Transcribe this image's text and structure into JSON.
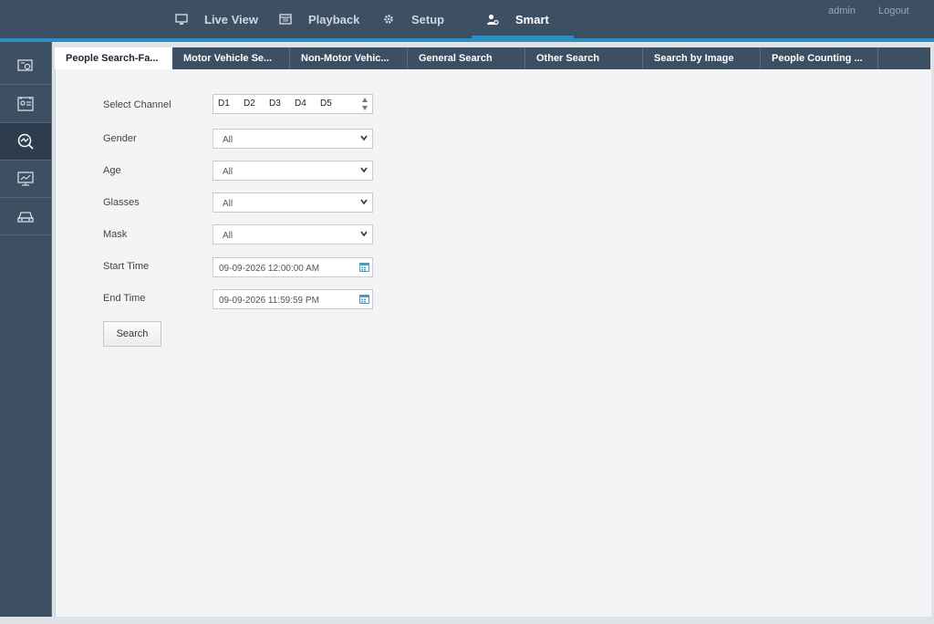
{
  "header": {
    "nav": [
      {
        "label": "Live View",
        "icon": "monitor-icon"
      },
      {
        "label": "Playback",
        "icon": "film-icon"
      },
      {
        "label": "Setup",
        "icon": "gear-icon"
      },
      {
        "label": "Smart",
        "icon": "smart-person-icon"
      }
    ],
    "active_nav": "Smart",
    "user": "admin",
    "logout": "Logout"
  },
  "sidebar": {
    "items": [
      {
        "icon": "camera-settings-icon"
      },
      {
        "icon": "face-card-icon"
      },
      {
        "icon": "analytics-search-icon",
        "active": true
      },
      {
        "icon": "chart-monitor-icon"
      },
      {
        "icon": "car-icon"
      }
    ]
  },
  "tabs": [
    {
      "label": "People Search-Fa..."
    },
    {
      "label": "Motor Vehicle Se..."
    },
    {
      "label": "Non-Motor Vehic..."
    },
    {
      "label": "General Search"
    },
    {
      "label": "Other Search"
    },
    {
      "label": "Search by Image"
    },
    {
      "label": "People Counting ..."
    }
  ],
  "form": {
    "select_channel_label": "Select Channel",
    "channels": [
      "D1",
      "D2",
      "D3",
      "D4",
      "D5"
    ],
    "gender_label": "Gender",
    "gender_value": "All",
    "age_label": "Age",
    "age_value": "All",
    "glasses_label": "Glasses",
    "glasses_value": "All",
    "mask_label": "Mask",
    "mask_value": "All",
    "start_time_label": "Start Time",
    "start_time_value": "09-09-2026 12:00:00 AM",
    "end_time_label": "End Time",
    "end_time_value": "09-09-2026 11:59:59 PM",
    "search_button": "Search"
  },
  "colors": {
    "header_bg": "#3d4f63",
    "accent": "#2a8fc0",
    "panel_bg": "#f3f4f6"
  }
}
